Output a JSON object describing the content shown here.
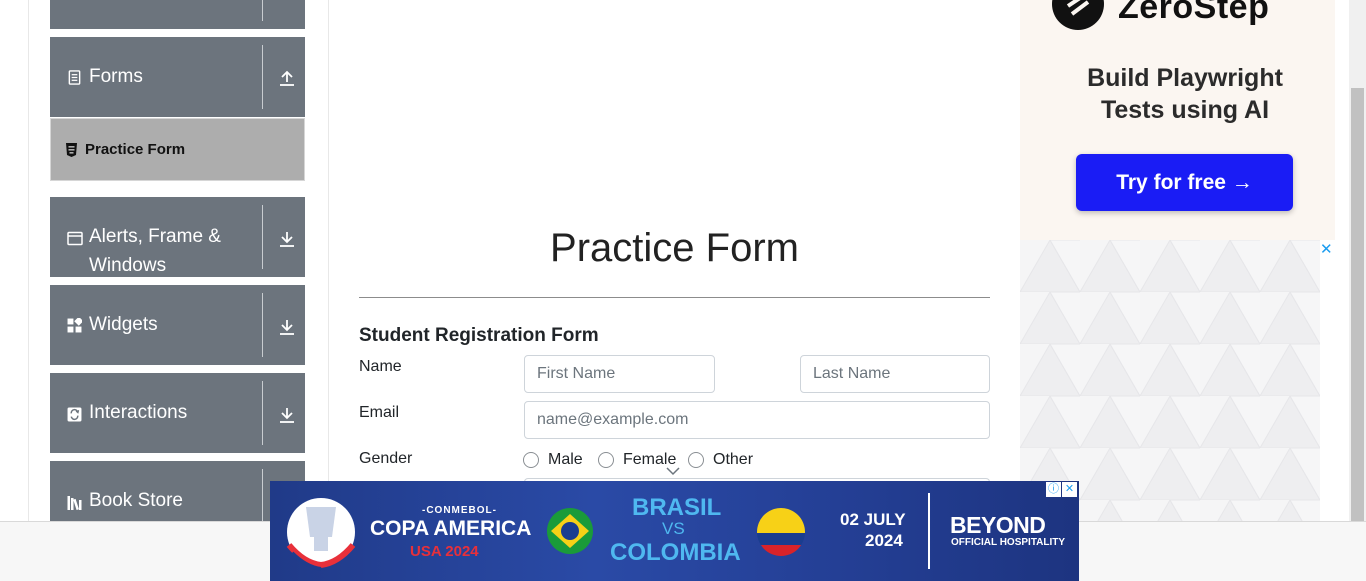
{
  "sidebar": {
    "groups": [
      {
        "label": "Forms",
        "icon": "document-icon",
        "expanded": true
      },
      {
        "label": "Alerts, Frame &",
        "label2": "Windows",
        "icon": "window-icon"
      },
      {
        "label": "Widgets",
        "icon": "widgets-icon"
      },
      {
        "label": "Interactions",
        "icon": "interactions-icon"
      },
      {
        "label": "Book Store",
        "icon": "books-icon"
      }
    ],
    "active_item": "Practice Form"
  },
  "main": {
    "title": "Practice Form",
    "form_heading": "Student Registration Form",
    "name_label": "Name",
    "first_name_placeholder": "First Name",
    "last_name_placeholder": "Last Name",
    "email_label": "Email",
    "email_placeholder": "name@example.com",
    "gender_label": "Gender",
    "gender_options": [
      "Male",
      "Female",
      "Other"
    ]
  },
  "ad_right": {
    "brand": "ZeroStep",
    "tagline_1": "Build Playwright",
    "tagline_2": "Tests using AI",
    "cta": "Try for free →",
    "close": "✕"
  },
  "ad_bottom": {
    "conmebol": "-CONMEBOL-",
    "tournament": "COPA AMERICA",
    "host": "USA 2024",
    "team1": "BRASIL",
    "vs": "VS",
    "team2": "COLOMBIA",
    "date_1": "02 JULY",
    "date_2": "2024",
    "sponsor": "BEYOND",
    "sponsor_sub": "OFFICIAL HOSPITALITY",
    "info": "ⓘ",
    "close": "✕"
  }
}
